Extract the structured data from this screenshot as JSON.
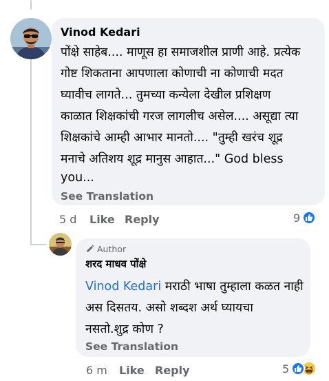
{
  "comment": {
    "author": "Vinod Kedari",
    "lines": [
      "पोंक्षे साहेब.... माणूस हा समाजशील प्राणी आहे. प्रत्येक",
      "गोष्ट शिकताना आपणाला कोणाची ना कोणाची मदत",
      "घ्यावीच लागते... तुमच्या कन्येला देखील प्रशिक्षण",
      "काळात शिक्षकांची गरज लागलीच असेल.... असूद्या त्या",
      "शिक्षकांचे आम्ही आभार मानतो.... \"तुम्ही खरंच शूद्र",
      "मनाचे अतिशय शूद्र मानुस आहात...\" God bless",
      "you..."
    ],
    "see_translation": "See Translation",
    "time": "5 d",
    "like_label": "Like",
    "reply_label": "Reply",
    "reaction_count": "9",
    "reaction_icons": [
      "like-icon"
    ]
  },
  "reply": {
    "badge": "Author",
    "author": "शरद माधव पोंक्षे",
    "mention": "Vinod Kedari",
    "lines": [
      " मराठी भाषा तुम्हाला कळत नाही",
      "अस दिसतय. असो शब्दश अर्थ घ्यायचा",
      "नसतो.शुद्र कोण ?"
    ],
    "see_translation": "See Translation",
    "time": "6 m",
    "like_label": "Like",
    "reply_label": "Reply",
    "reaction_count": "5",
    "reaction_icons": [
      "like-icon",
      "haha-icon"
    ]
  },
  "colors": {
    "bubble": "#f0f2f5",
    "secondary_text": "#65676b",
    "link": "#216fdb",
    "like_blue": "#1877f2"
  }
}
